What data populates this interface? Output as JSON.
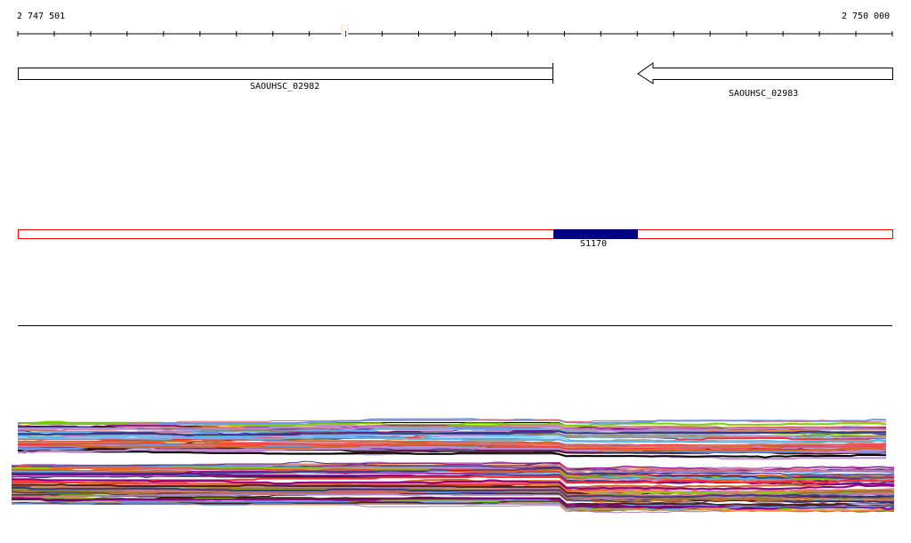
{
  "ruler": {
    "start_label": "2 747 501",
    "end_label": "2 750 000",
    "start": 2747501,
    "end": 2750000,
    "tick_count": 25
  },
  "genes": [
    {
      "name": "SAOUHSC_02982",
      "strand": "+",
      "start": 2747501,
      "end": 2749031
    },
    {
      "name": "SAOUHSC_02983",
      "strand": "-",
      "start": 2749271,
      "end": 2750000
    }
  ],
  "feature_track": {
    "feature": {
      "name": "S1170",
      "start": 2749031,
      "end": 2749271
    },
    "track_color": "#ff0000",
    "feature_color": "#000080"
  },
  "coverage_palette": [
    "#000000",
    "#5bb8f5",
    "#a67fbf",
    "#d2691e",
    "#7fd000",
    "#8b008b",
    "#ff3030",
    "#8b7d2a",
    "#c08ad0",
    "#4a2020",
    "#ff8c40",
    "#6495ed",
    "#e07070",
    "#3a3a8a"
  ]
}
